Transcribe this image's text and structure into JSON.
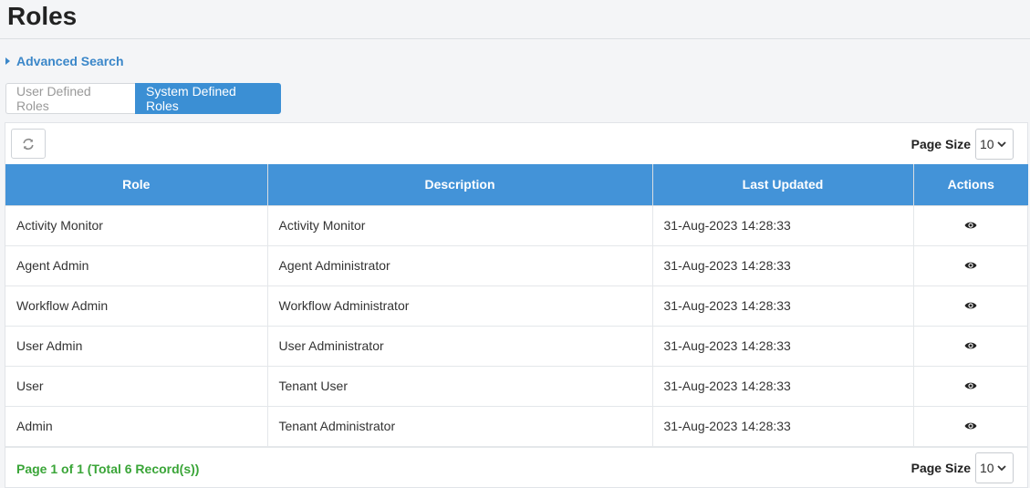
{
  "page": {
    "title": "Roles"
  },
  "advanced_search": {
    "label": "Advanced Search"
  },
  "tabs": [
    {
      "label": "User Defined Roles",
      "active": false
    },
    {
      "label": "System Defined Roles",
      "active": true
    }
  ],
  "toolbar": {
    "refresh_icon": "refresh-icon",
    "page_size_label": "Page Size",
    "page_size_value": "10"
  },
  "table": {
    "columns": [
      "Role",
      "Description",
      "Last Updated",
      "Actions"
    ],
    "rows": [
      {
        "role": "Activity Monitor",
        "description": "Activity Monitor",
        "last_updated": "31-Aug-2023 14:28:33",
        "action_icon": "eye-icon"
      },
      {
        "role": "Agent Admin",
        "description": "Agent Administrator",
        "last_updated": "31-Aug-2023 14:28:33",
        "action_icon": "eye-icon"
      },
      {
        "role": "Workflow Admin",
        "description": "Workflow Administrator",
        "last_updated": "31-Aug-2023 14:28:33",
        "action_icon": "eye-icon"
      },
      {
        "role": "User Admin",
        "description": "User Administrator",
        "last_updated": "31-Aug-2023 14:28:33",
        "action_icon": "eye-icon"
      },
      {
        "role": "User",
        "description": "Tenant User",
        "last_updated": "31-Aug-2023 14:28:33",
        "action_icon": "eye-icon"
      },
      {
        "role": "Admin",
        "description": "Tenant Administrator",
        "last_updated": "31-Aug-2023 14:28:33",
        "action_icon": "eye-icon"
      }
    ]
  },
  "footer": {
    "pager_text": "Page 1 of 1 (Total 6 Record(s))",
    "page_size_label": "Page Size",
    "page_size_value": "10"
  },
  "colors": {
    "accent": "#3b8fd4",
    "header_bg": "#4393d8",
    "link": "#3b87c9",
    "success": "#3aa538"
  }
}
